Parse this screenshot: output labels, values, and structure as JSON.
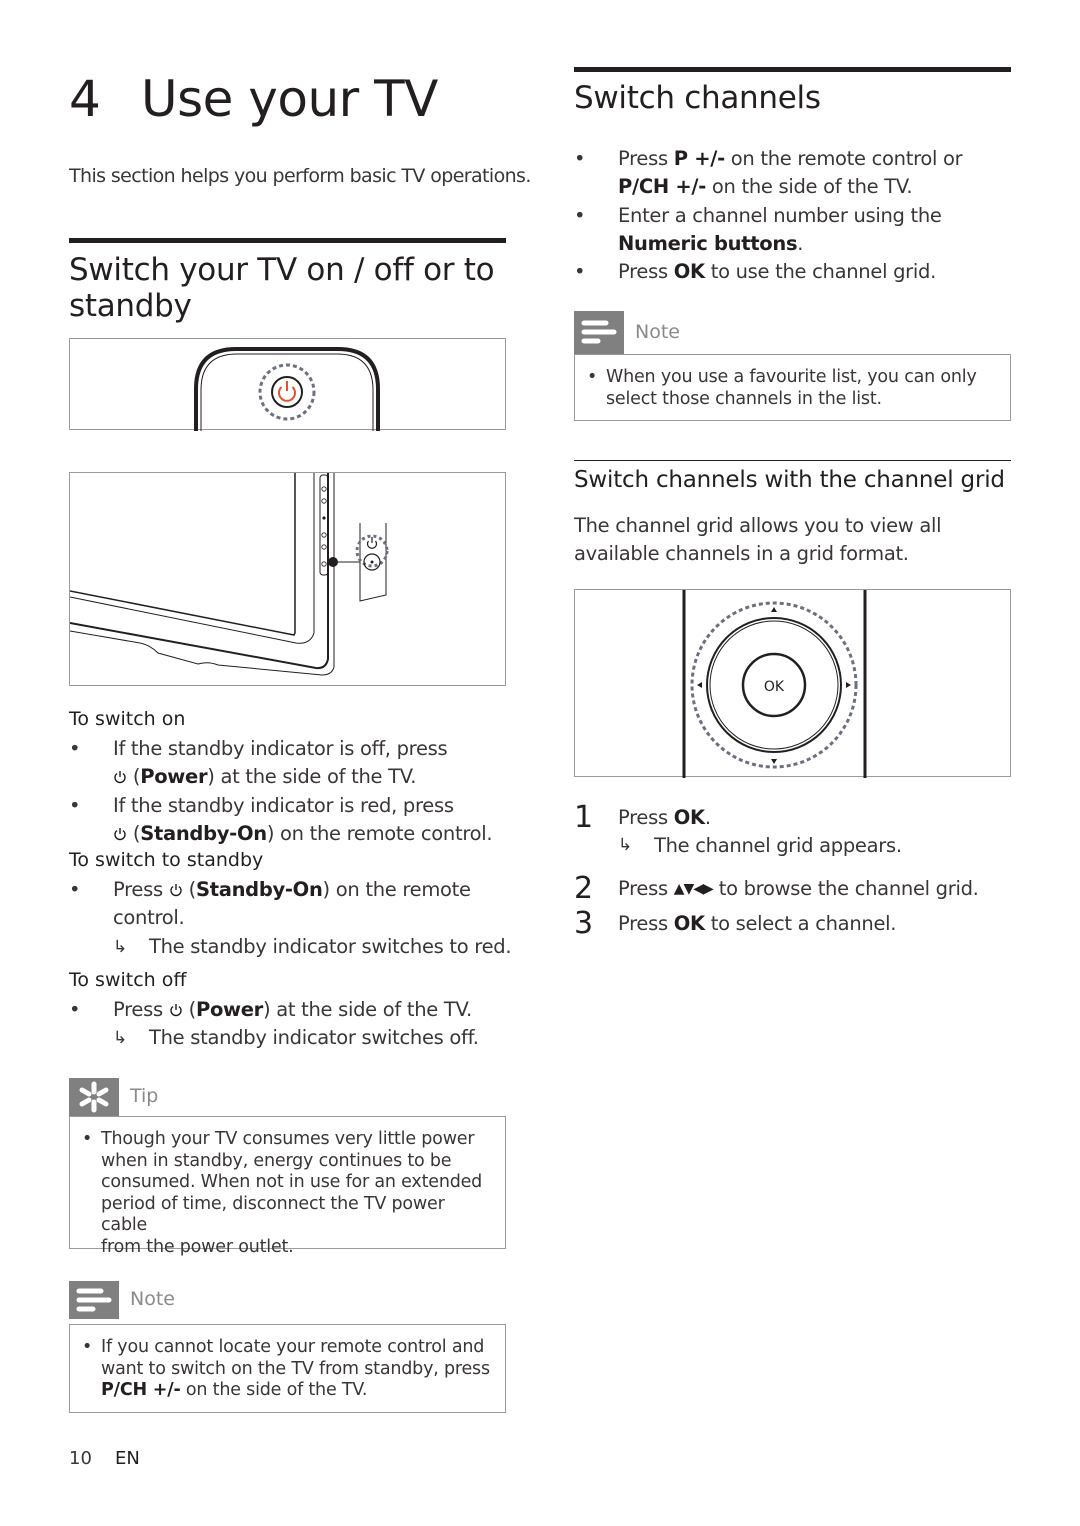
{
  "chapter": {
    "number": "4",
    "title": "Use your TV",
    "intro": "This section helps you perform basic TV operations."
  },
  "power_section": {
    "heading": "Switch your TV on / off or to standby",
    "figure_remote_label": "remote-control-power-button-illustration",
    "figure_tv_label": "tv-side-power-button-illustration",
    "switch_on": {
      "title": "To switch on",
      "items": [
        {
          "text_before": "If the standby indicator is off, press",
          "icon": "power-icon",
          "bold": "Power",
          "text_after": "at the side of the TV."
        },
        {
          "text_before": "If the standby indicator is red, press",
          "icon": "power-icon",
          "bold": "Standby-On",
          "text_after": "on the remote control."
        }
      ]
    },
    "switch_standby": {
      "title": "To switch to standby",
      "items": [
        {
          "text_before": "Press",
          "icon": "power-icon",
          "bold": "Standby-On",
          "text_after": "on the remote",
          "text_cont": "control.",
          "result": "The standby indicator switches to red."
        }
      ]
    },
    "switch_off": {
      "title": "To switch off",
      "items": [
        {
          "text_before": "Press",
          "icon": "power-icon",
          "bold": "Power",
          "text_after": "at the side of the TV.",
          "result": "The standby indicator switches off."
        }
      ]
    },
    "tip": {
      "label": "Tip",
      "icon": "tip-asterisk-icon",
      "lines": [
        "Though your TV consumes very little power",
        "when in standby, energy continues to be",
        "consumed. When not in use for an extended",
        "period of time, disconnect the TV power cable",
        "from the power outlet."
      ]
    },
    "note": {
      "label": "Note",
      "icon": "note-lines-icon",
      "lines": [
        "If you cannot locate your remote control and",
        "want to switch on the TV from standby, press"
      ],
      "last_bold": "P/CH +/-",
      "last_text": "on the side of the TV."
    }
  },
  "channels_section": {
    "heading": "Switch channels",
    "items": [
      {
        "p1": "Press",
        "b1": "P +/-",
        "p2": "on the remote control or",
        "b2": "P/CH +/-",
        "p3": "on the side of the TV."
      },
      {
        "p1": "Enter a channel number using the",
        "b1": "Numeric buttons",
        "p2": "."
      },
      {
        "p1": "Press",
        "b1": "OK",
        "p2": "to use the channel grid."
      }
    ],
    "note": {
      "label": "Note",
      "icon": "note-lines-icon",
      "lines": [
        "When you use a favourite list, you can only",
        "select those channels in the list."
      ]
    }
  },
  "grid_section": {
    "heading": "Switch channels with the channel grid",
    "intro_lines": [
      "The channel grid allows you to view all",
      "available channels in a grid format."
    ],
    "figure": {
      "ok_label": "OK"
    },
    "steps": [
      {
        "num": "1",
        "pre": "Press",
        "bold": "OK",
        "post": ".",
        "result": "The channel grid appears."
      },
      {
        "num": "2",
        "pre": "Press",
        "arrows": "▲▼◀▶",
        "post": "to browse the channel grid."
      },
      {
        "num": "3",
        "pre": "Press",
        "bold": "OK",
        "post": "to select a channel."
      }
    ]
  },
  "footer": {
    "page_number": "10",
    "language": "EN"
  },
  "symbols": {
    "bullet": "•",
    "result_arrow": "↳"
  },
  "colors": {
    "text": "#231f20",
    "body_text": "#3a3536",
    "power_red": "#ee4b2b",
    "highlight_dash": "#6b6f80",
    "callout_gray": "#808080"
  }
}
